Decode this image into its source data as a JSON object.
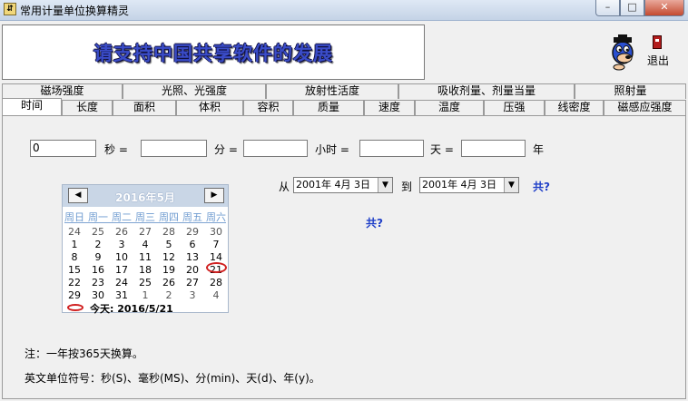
{
  "window": {
    "title": "常用计量单位换算精灵",
    "controls": {
      "minimize": "–",
      "maximize": "□",
      "close": "✕"
    }
  },
  "banner": {
    "text": "请支持中国共享软件的发展"
  },
  "exit": {
    "label": "退出",
    "icon": "door-icon"
  },
  "tabs_row1": [
    "磁场强度",
    "光照、光强度",
    "放射性活度",
    "吸收剂量、剂量当量",
    "照射量"
  ],
  "tabs_row2": [
    "时间",
    "长度",
    "面积",
    "体积",
    "容积",
    "质量",
    "速度",
    "温度",
    "压强",
    "线密度",
    "磁感应强度"
  ],
  "selected_tab": "时间",
  "converter": {
    "seconds_value": "0",
    "units": [
      "秒 =",
      "分 =",
      "小时 =",
      "天 =",
      "年"
    ]
  },
  "range": {
    "from_label": "从",
    "from_date": "2001年 4月 3日",
    "to_label": "到",
    "to_date": "2001年 4月 3日",
    "total_label": "共?",
    "result": "共?"
  },
  "calendar": {
    "month": "2016年5月",
    "weekdays": [
      "周日",
      "周一",
      "周二",
      "周三",
      "周四",
      "周五",
      "周六"
    ],
    "weeks": [
      [
        "24",
        "25",
        "26",
        "27",
        "28",
        "29",
        "30"
      ],
      [
        "1",
        "2",
        "3",
        "4",
        "5",
        "6",
        "7"
      ],
      [
        "8",
        "9",
        "10",
        "11",
        "12",
        "13",
        "14"
      ],
      [
        "15",
        "16",
        "17",
        "18",
        "19",
        "20",
        "21"
      ],
      [
        "22",
        "23",
        "24",
        "25",
        "26",
        "27",
        "28"
      ],
      [
        "29",
        "30",
        "31",
        "1",
        "2",
        "3",
        "4"
      ]
    ],
    "today_label": "今天: 2016/5/21",
    "prev": "◀",
    "next": "▶"
  },
  "notes": {
    "line1": "注：一年按365天换算。",
    "line2": "英文单位符号：秒(S)、毫秒(MS)、分(min)、天(d)、年(y)。"
  }
}
